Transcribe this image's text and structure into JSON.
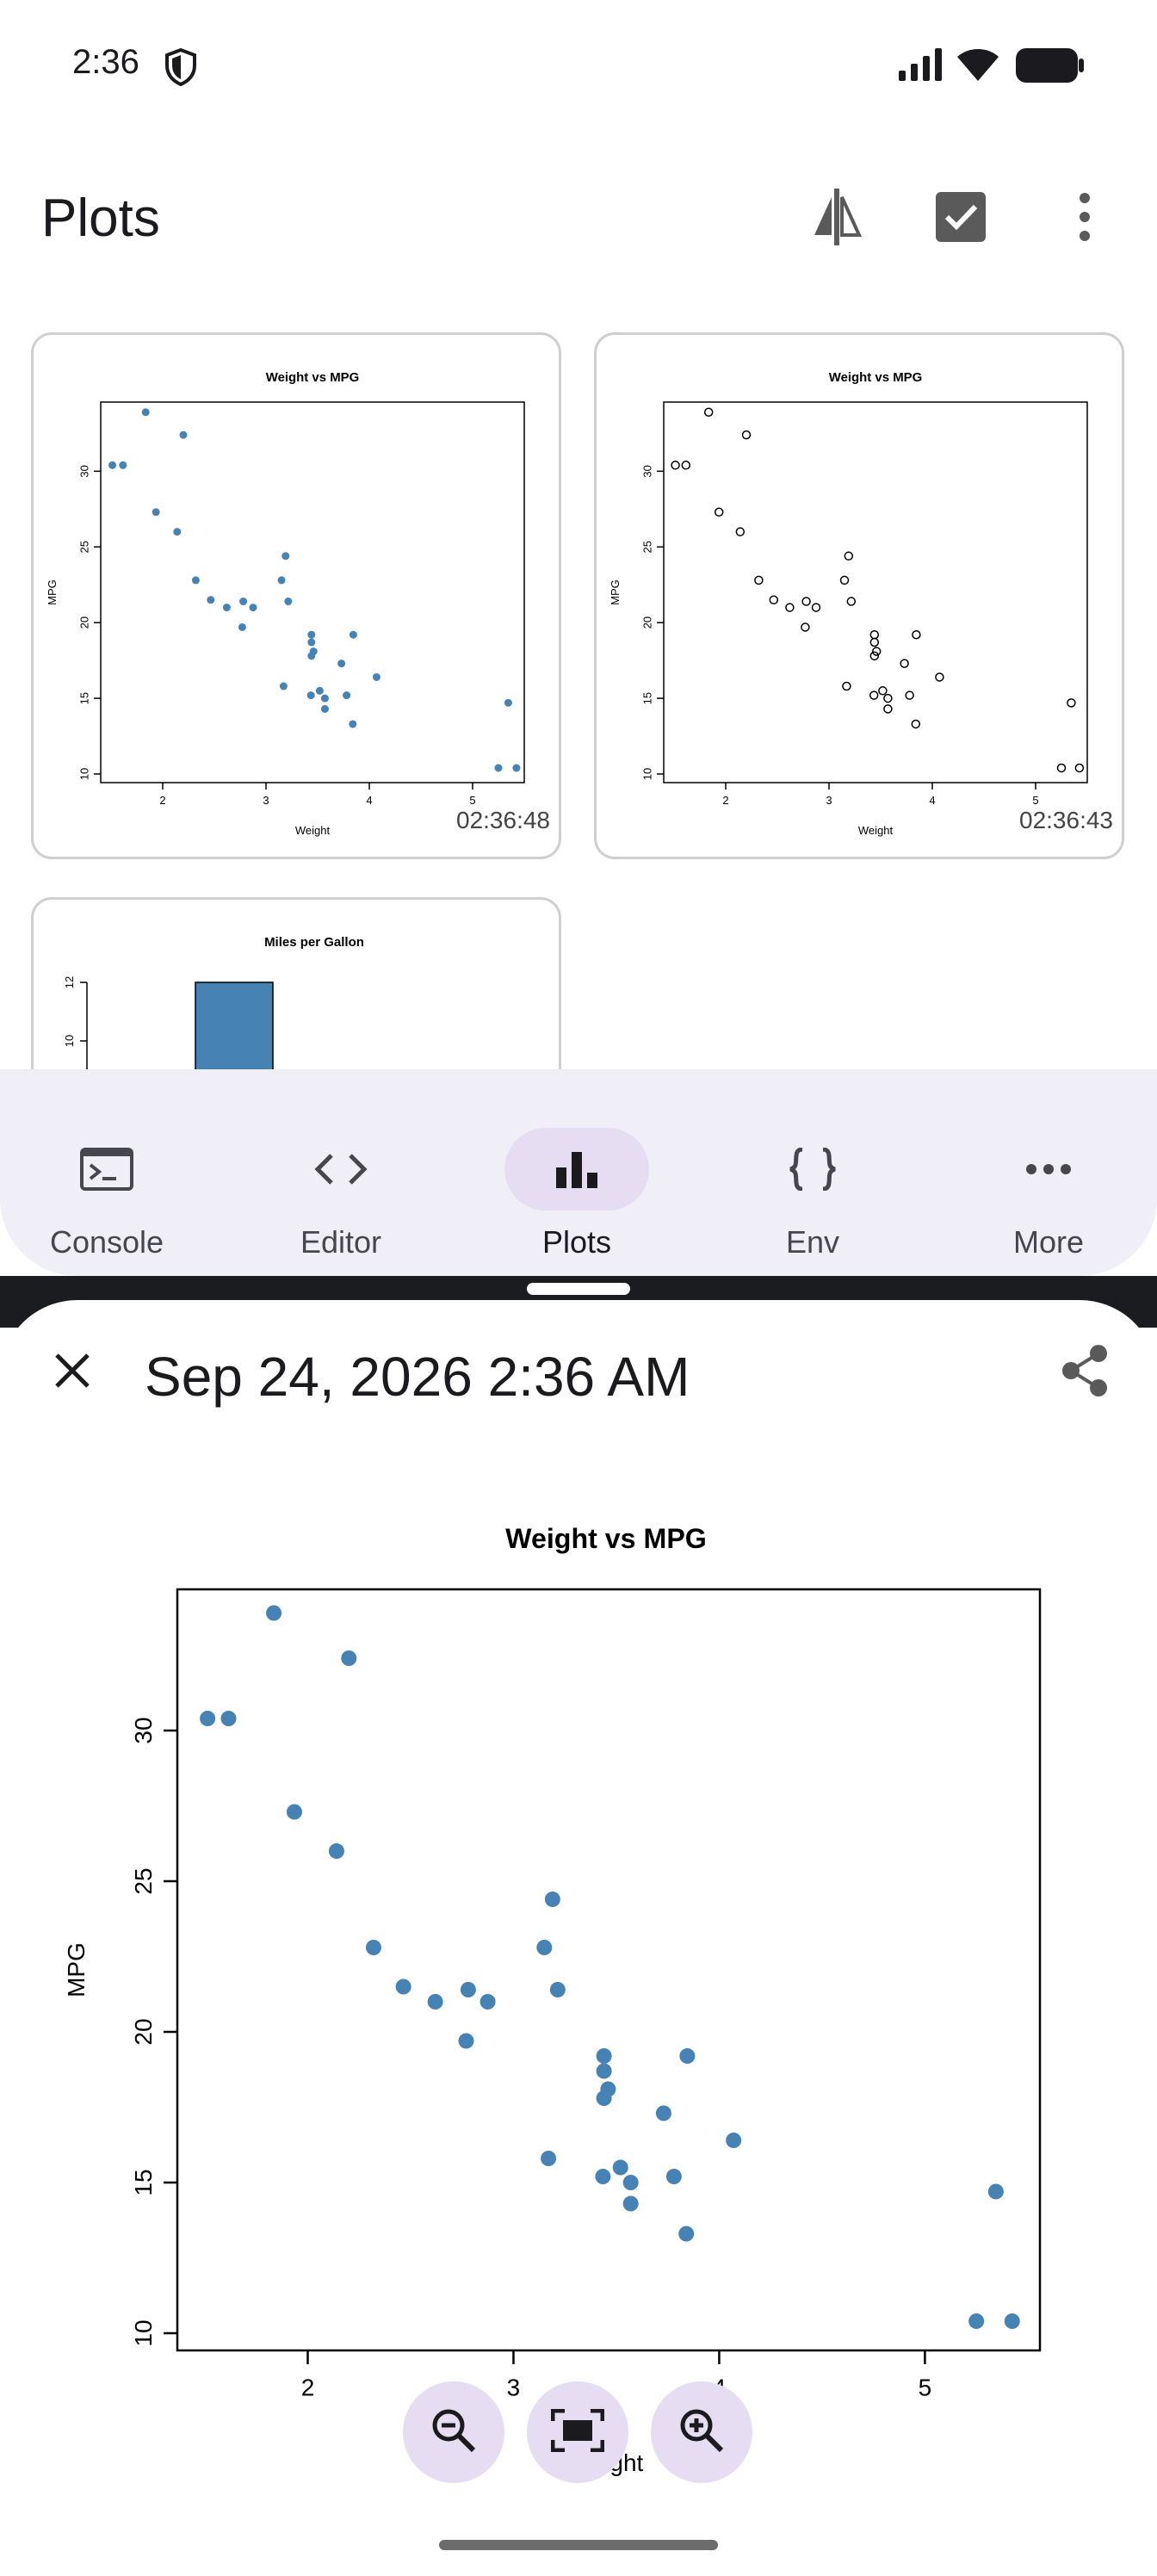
{
  "status_bar": {
    "time": "2:36"
  },
  "app_bar": {
    "title": "Plots"
  },
  "thumbnails": [
    {
      "timestamp": "02:36:48"
    },
    {
      "timestamp": "02:36:43"
    },
    {
      "timestamp": ""
    }
  ],
  "nav": {
    "items": [
      {
        "label": "Console",
        "icon": "terminal-icon"
      },
      {
        "label": "Editor",
        "icon": "code-icon"
      },
      {
        "label": "Plots",
        "icon": "bar-chart-icon",
        "selected": true
      },
      {
        "label": "Env",
        "icon": "braces-icon"
      },
      {
        "label": "More",
        "icon": "more-horizontal-icon"
      }
    ]
  },
  "detail": {
    "title": "Sep 24, 2026 2:36 AM",
    "zoom_out_icon": "zoom-out-icon",
    "fit_icon": "fit-screen-icon",
    "zoom_in_icon": "zoom-in-icon"
  },
  "colors": {
    "point": "#4682b4",
    "nav_bg": "#f0eef6",
    "accent": "#e6ddf3"
  },
  "chart_data": [
    {
      "type": "scatter",
      "title": "Weight vs MPG",
      "xlabel": "Weight",
      "ylabel": "MPG",
      "xlim": [
        1.5,
        5.4
      ],
      "ylim": [
        10,
        34
      ],
      "xticks": [
        2,
        3,
        4,
        5
      ],
      "yticks": [
        10,
        15,
        20,
        25,
        30
      ],
      "point_style": "filled",
      "timestamp": "02:36:48",
      "points": [
        [
          2.62,
          21.0
        ],
        [
          2.875,
          21.0
        ],
        [
          2.32,
          22.8
        ],
        [
          3.215,
          21.4
        ],
        [
          3.44,
          18.7
        ],
        [
          3.46,
          18.1
        ],
        [
          3.57,
          14.3
        ],
        [
          3.19,
          24.4
        ],
        [
          3.15,
          22.8
        ],
        [
          3.44,
          19.2
        ],
        [
          3.44,
          17.8
        ],
        [
          4.07,
          16.4
        ],
        [
          3.73,
          17.3
        ],
        [
          3.78,
          15.2
        ],
        [
          5.25,
          10.4
        ],
        [
          5.424,
          10.4
        ],
        [
          5.345,
          14.7
        ],
        [
          2.2,
          32.4
        ],
        [
          1.615,
          30.4
        ],
        [
          1.835,
          33.9
        ],
        [
          2.465,
          21.5
        ],
        [
          3.52,
          15.5
        ],
        [
          3.435,
          15.2
        ],
        [
          3.84,
          13.3
        ],
        [
          3.845,
          19.2
        ],
        [
          1.935,
          27.3
        ],
        [
          2.14,
          26.0
        ],
        [
          1.513,
          30.4
        ],
        [
          3.17,
          15.8
        ],
        [
          2.77,
          19.7
        ],
        [
          3.57,
          15.0
        ],
        [
          2.78,
          21.4
        ]
      ]
    },
    {
      "type": "scatter",
      "title": "Weight vs MPG",
      "xlabel": "Weight",
      "ylabel": "MPG",
      "xticks": [
        2,
        3,
        4,
        5
      ],
      "yticks": [
        10,
        15,
        20,
        25,
        30
      ],
      "point_style": "open",
      "timestamp": "02:36:43"
    },
    {
      "type": "bar",
      "title": "Miles per Gallon",
      "yticks": [
        10,
        12
      ],
      "values": [
        12
      ]
    }
  ]
}
